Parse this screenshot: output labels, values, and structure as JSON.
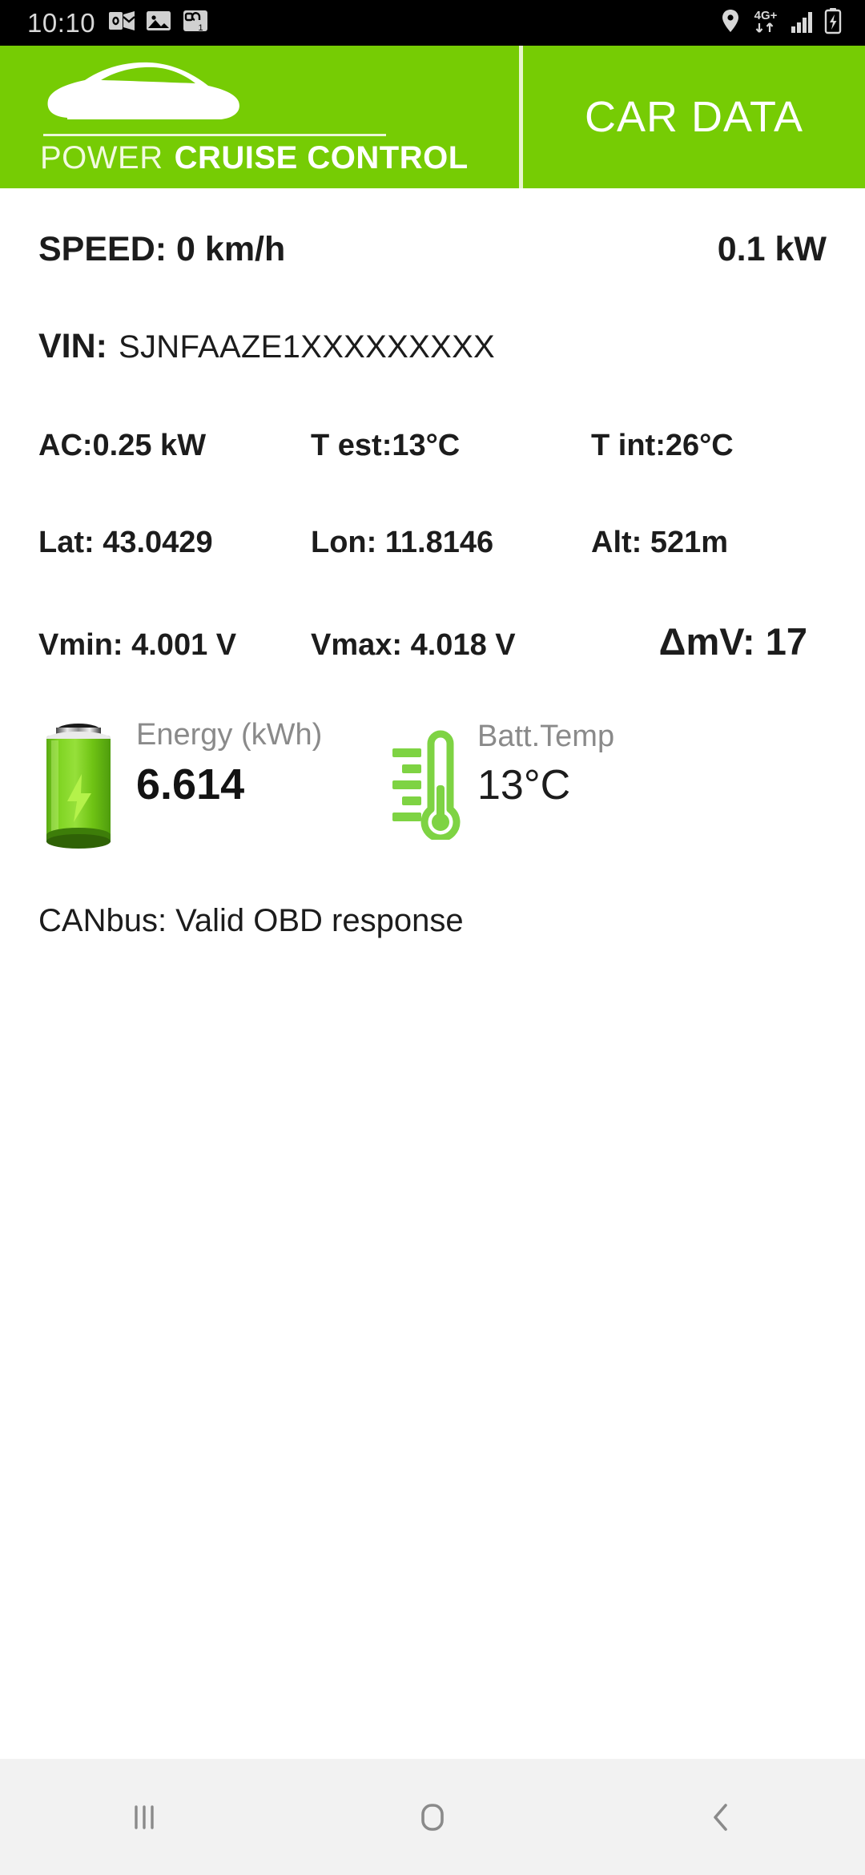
{
  "status_bar": {
    "time": "10:10",
    "left_icons": [
      "outlook-icon",
      "gallery-image-icon",
      "qr-badge-icon"
    ],
    "right_icons": [
      "location-pin-icon",
      "network-4g-plus-icon",
      "signal-bars-icon",
      "battery-charging-icon"
    ],
    "network_label": "4G+",
    "background": "#000000"
  },
  "app_bar": {
    "brand_word_1": "POWER",
    "brand_word_2": "CRUISE CONTROL",
    "title": "CAR DATA",
    "logo_icon": "car-silhouette-icon",
    "background": "#76cc04"
  },
  "car_data": {
    "speed": "SPEED: 0 km/h",
    "power": "0.1 kW",
    "vin_label": "VIN:",
    "vin_value": "SJNFAAZE1XXXXXXXXX",
    "ac": "AC:0.25 kW",
    "t_est": "T est:13°C",
    "t_int": "T int:26°C",
    "lat": "Lat: 43.0429",
    "lon": "Lon: 11.8146",
    "alt": "Alt: 521m",
    "vmin": "Vmin: 4.001 V",
    "vmax": "Vmax: 4.018 V",
    "delta_mv": "ΔmV: 17",
    "canbus": "CANbus: Valid OBD response"
  },
  "gauges": {
    "energy": {
      "icon": "battery-charging-icon",
      "label": "Energy (kWh)",
      "value": "6.614"
    },
    "batt_temp": {
      "icon": "thermometer-icon",
      "label": "Batt.Temp",
      "value": "13°C"
    },
    "accent_color": "#76cc04"
  },
  "nav_bar": {
    "recents_label": "recents-icon",
    "home_label": "home-icon",
    "back_label": "back-icon",
    "background": "#f2f2f2"
  }
}
